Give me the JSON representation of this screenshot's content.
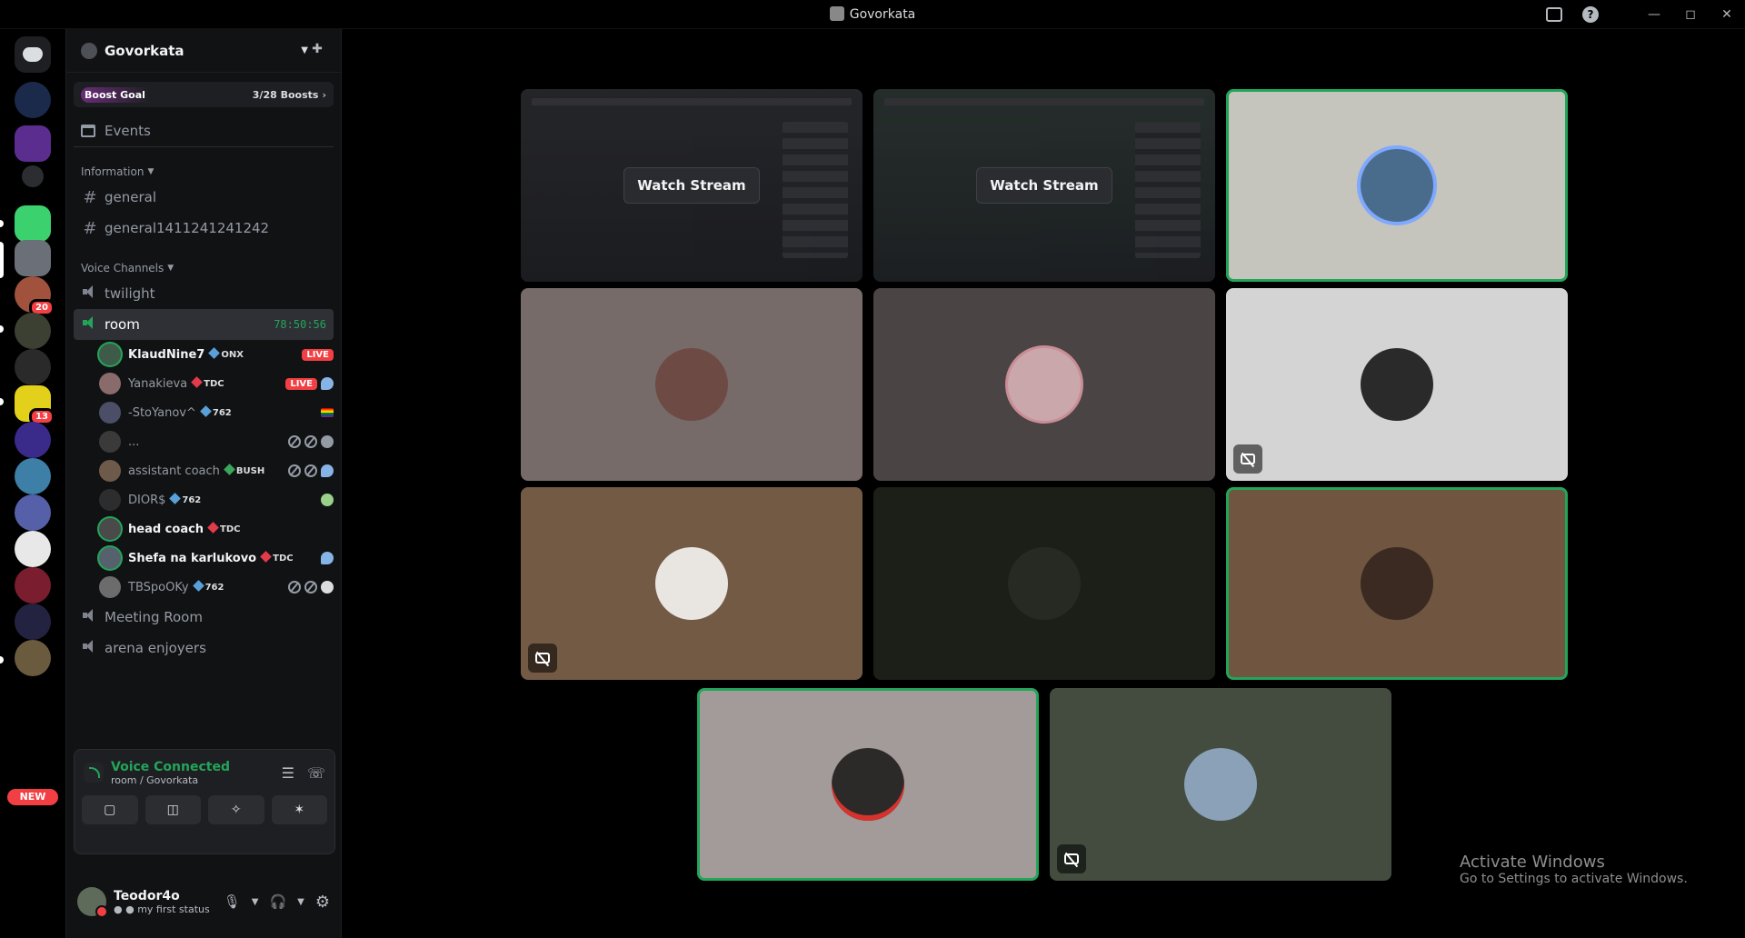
{
  "window": {
    "title": "Govorkata"
  },
  "server": {
    "name": "Govorkata"
  },
  "boost": {
    "goal_label": "Boost Goal",
    "count": "3/28 Boosts"
  },
  "events_label": "Events",
  "categories": {
    "information": {
      "label": "Information"
    },
    "voice": {
      "label": "Voice Channels"
    }
  },
  "text_channels": [
    {
      "name": "general"
    },
    {
      "name": "general1411241241242"
    }
  ],
  "voice_channels": {
    "twilight": {
      "name": "twilight"
    },
    "room": {
      "name": "room",
      "timer": "78:50:56"
    },
    "meeting": {
      "name": "Meeting Room"
    },
    "arena": {
      "name": "arena enjoyers"
    }
  },
  "voice_users": [
    {
      "name": "KlaudNine7",
      "tag": "ONX",
      "live": "LIVE"
    },
    {
      "name": "Yanakieva",
      "tag": "TDC",
      "live": "LIVE"
    },
    {
      "name": "-StoYanov^",
      "tag": "762"
    },
    {
      "name": "..."
    },
    {
      "name": "assistant coach",
      "tag": "BUSH"
    },
    {
      "name": "DIOR$",
      "tag": "762"
    },
    {
      "name": "head coach",
      "tag": "TDC"
    },
    {
      "name": "Shefa na karlukovo",
      "tag": "TDC"
    },
    {
      "name": "TBSpoOKy",
      "tag": "762"
    }
  ],
  "voice_panel": {
    "title": "Voice Connected",
    "subtitle": "room / Govorkata"
  },
  "user_panel": {
    "name": "Teodor4o",
    "status": "my first status"
  },
  "stage": {
    "watch_label": "Watch Stream"
  },
  "guild_badges": {
    "g7": "20",
    "g10": "13",
    "new": "NEW"
  },
  "activate": {
    "title": "Activate Windows",
    "subtitle": "Go to Settings to activate Windows."
  },
  "colors": {
    "accent_green": "#23a559",
    "live_red": "#f23f43",
    "sidebar_bg": "#111214"
  }
}
